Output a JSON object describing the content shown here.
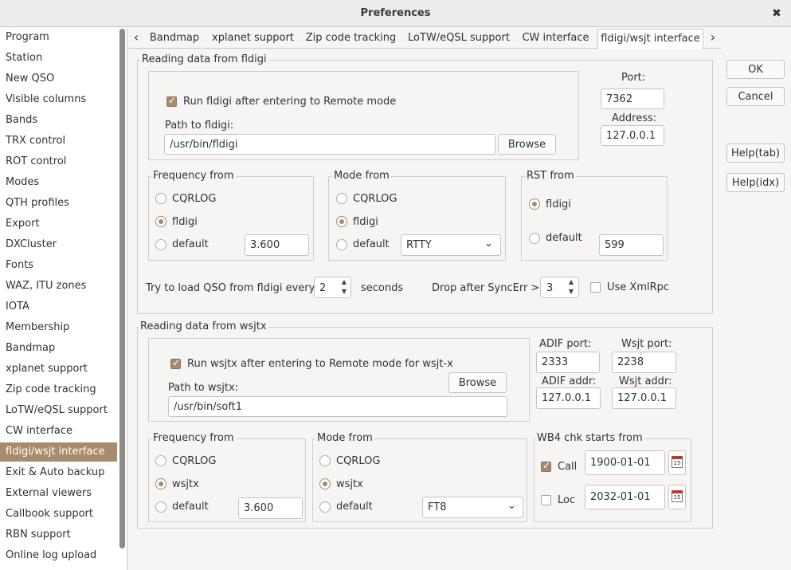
{
  "window": {
    "title": "Preferences",
    "close_icon": "close-icon"
  },
  "sidebar": {
    "items": [
      "Program",
      "Station",
      "New QSO",
      "Visible columns",
      "Bands",
      "TRX control",
      "ROT control",
      "Modes",
      "QTH profiles",
      "Export",
      "DXCluster",
      "Fonts",
      "WAZ, ITU zones",
      "IOTA",
      "Membership",
      "Bandmap",
      "xplanet support",
      "Zip code tracking",
      "LoTW/eQSL support",
      "CW interface",
      "fldigi/wsjt interface",
      "Exit & Auto backup",
      "External viewers",
      "Callbook support",
      "RBN support",
      "Online log upload"
    ],
    "selected": "fldigi/wsjt interface"
  },
  "tabs": [
    "Bandmap",
    "xplanet support",
    "Zip code tracking",
    "LoTW/eQSL support",
    "CW interface",
    "fldigi/wsjt interface"
  ],
  "active_tab": "fldigi/wsjt interface",
  "buttons": {
    "ok": "OK",
    "cancel": "Cancel",
    "help_tab": "Help(tab)",
    "help_idx": "Help(idx)"
  },
  "fldigi": {
    "group_title": "Reading data from fldigi",
    "run_label": "Run fldigi after entering to Remote mode",
    "run_checked": true,
    "path_label": "Path to fldigi:",
    "path_value": "/usr/bin/fldigi",
    "browse": "Browse",
    "port_label": "Port:",
    "port_value": "7362",
    "address_label": "Address:",
    "address_value": "127.0.0.1",
    "freq": {
      "title": "Frequency from",
      "options": [
        "CQRLOG",
        "fldigi",
        "default"
      ],
      "selected": "fldigi",
      "default_value": "3.600"
    },
    "mode": {
      "title": "Mode from",
      "options": [
        "CQRLOG",
        "fldigi",
        "default"
      ],
      "selected": "fldigi",
      "default_value": "RTTY"
    },
    "rst": {
      "title": "RST from",
      "options": [
        "fldigi",
        "default"
      ],
      "selected": "fldigi",
      "default_value": "599"
    },
    "load_label": "Try to load QSO from fldigi every",
    "load_value": "2",
    "seconds_label": "seconds",
    "drop_label": "Drop after  SyncErr >",
    "drop_value": "3",
    "xmlrpc_label": "Use XmlRpc",
    "xmlrpc_checked": false
  },
  "wsjtx": {
    "group_title": "Reading data from wsjtx",
    "run_label": "Run wsjtx after entering to Remote mode for wsjt-x",
    "run_checked": true,
    "path_label": "Path to wsjtx:",
    "path_value": "/usr/bin/soft1",
    "browse": "Browse",
    "adif_port_label": "ADIF port:",
    "adif_port_value": "2333",
    "wsjt_port_label": "Wsjt port:",
    "wsjt_port_value": "2238",
    "adif_addr_label": "ADIF addr:",
    "adif_addr_value": "127.0.0.1",
    "wsjt_addr_label": "Wsjt addr:",
    "wsjt_addr_value": "127.0.0.1",
    "freq": {
      "title": "Frequency from",
      "options": [
        "CQRLOG",
        "wsjtx",
        "default"
      ],
      "selected": "wsjtx",
      "default_value": "3.600"
    },
    "mode": {
      "title": "Mode from",
      "options": [
        "CQRLOG",
        "wsjtx",
        "default"
      ],
      "selected": "wsjtx",
      "default_value": "FT8"
    },
    "wb4": {
      "title": "WB4 chk starts from",
      "call_label": "Call",
      "call_checked": true,
      "call_date": "1900-01-01",
      "loc_label": "Loc",
      "loc_checked": false,
      "loc_date": "2032-01-01",
      "calendar_day": "15"
    }
  },
  "colors": {
    "accent": "#a88b6c",
    "background": "#f6f5f4"
  }
}
